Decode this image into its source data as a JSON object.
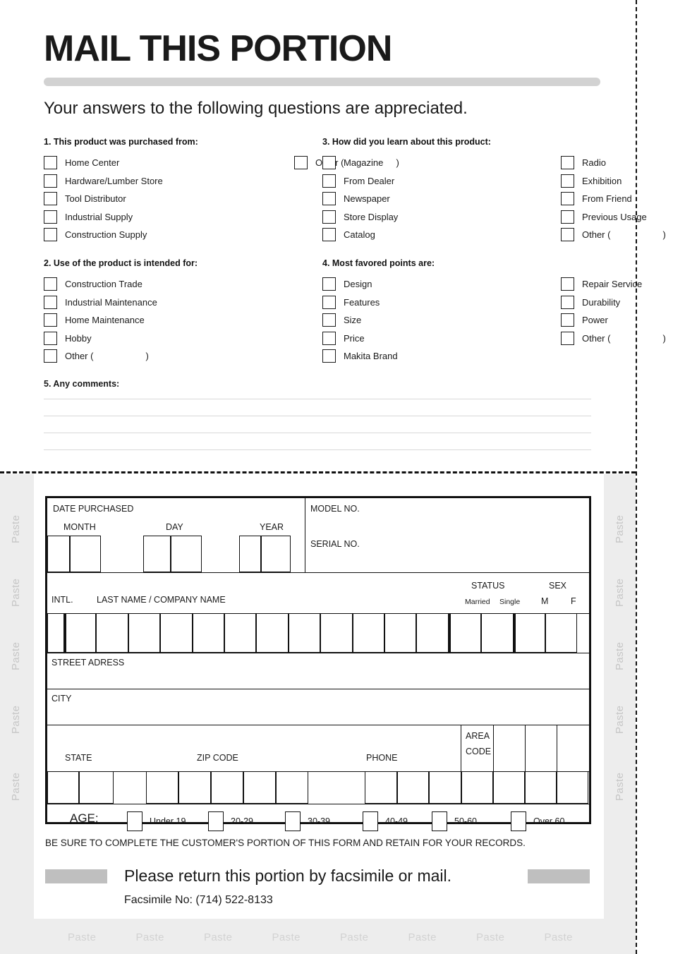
{
  "header": {
    "title": "MAIL THIS PORTION",
    "subtitle": "Your answers to the following questions are appreciated."
  },
  "questions": [
    {
      "id": "q1",
      "heading": "1. This product was purchased from:",
      "col1": [
        "Home Center",
        "Hardware/Lumber Store",
        "Tool Distributor",
        "Industrial Supply",
        "Construction Supply"
      ],
      "col2": [
        "Other ("
      ],
      "col2_close": [
        ")"
      ]
    },
    {
      "id": "q2",
      "heading": "2. Use of the product is intended for:",
      "col1": [
        "Construction Trade",
        "Industrial Maintenance",
        "Home Maintenance",
        "Hobby",
        "Other ("
      ],
      "col1_close_last": ")",
      "col2": []
    },
    {
      "id": "q3",
      "heading": "3. How did you learn about this product:",
      "col1": [
        "Magazine",
        "From Dealer",
        "Newspaper",
        "Store Display",
        "Catalog"
      ],
      "col2": [
        "Radio",
        "Exhibition",
        "From Friend",
        "Previous Usage",
        "Other ("
      ],
      "col2_close_last": ")"
    },
    {
      "id": "q4",
      "heading": "4. Most favored points are:",
      "col1": [
        "Design",
        "Features",
        "Size",
        "Price",
        "Makita Brand"
      ],
      "col2": [
        "Repair Service",
        "Durability",
        "Power",
        "Other ("
      ],
      "col2_close_last": ")"
    }
  ],
  "comments": {
    "heading": "5. Any comments:",
    "line_count": 4
  },
  "registration": {
    "date_purchased_label": "DATE PURCHASED",
    "month_label": "MONTH",
    "day_label": "DAY",
    "year_label": "YEAR",
    "model_no_label": "MODEL NO.",
    "serial_no_label": "SERIAL NO.",
    "intl_label": "INTL.",
    "last_name_label": "LAST NAME / COMPANY NAME",
    "status_label": "STATUS",
    "married_label": "Married",
    "single_label": "Single",
    "sex_label": "SEX",
    "male_label": "M",
    "female_label": "F",
    "street_label": "STREET ADRESS",
    "city_label": "CITY",
    "state_label": "STATE",
    "zip_label": "ZIP CODE",
    "phone_label": "PHONE",
    "area_label": "AREA",
    "code_label": "CODE",
    "age_label": "AGE:",
    "age_options": [
      "Under 19",
      "20-29",
      "30-39",
      "40-49",
      "50-60",
      "Over 60"
    ]
  },
  "footer": {
    "notice": "BE SURE TO COMPLETE THE CUSTOMER'S PORTION OF THIS FORM AND RETAIN FOR YOUR RECORDS.",
    "return_text": "Please return this portion by facsimile or mail.",
    "fax_text": "Facsimile No: (714) 522-8133"
  },
  "paste": {
    "label": "Paste",
    "left_count": 5,
    "right_count": 5,
    "bottom_count": 8
  },
  "colors": {
    "ink": "#1a1a1a",
    "rule": "#d8d8d8",
    "band": "#ededed",
    "greybar": "#bfbfbf",
    "titlebar": "#d2d2d2"
  }
}
